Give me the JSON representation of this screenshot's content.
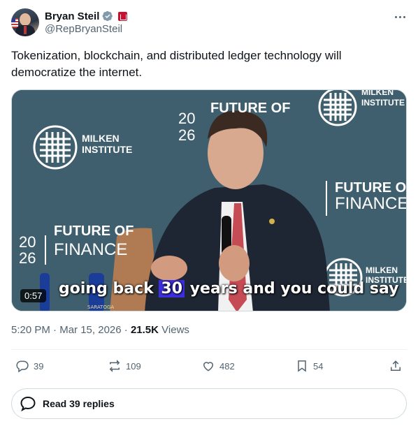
{
  "author": {
    "name": "Bryan Steil",
    "handle": "@RepBryanSteil"
  },
  "tweet": {
    "text": "Tokenization, blockchain, and distributed ledger technology will democratize the internet."
  },
  "video": {
    "duration": "0:57",
    "caption_before": "going back ",
    "caption_highlight": "30",
    "caption_after": " years and you could say",
    "backdrop": {
      "brand_line1": "MILKEN",
      "brand_line2": "INSTITUTE",
      "event_line1": "FUTURE OF",
      "event_line2": "FINANCE",
      "year_top": "20",
      "year_bottom": "26",
      "bottle_label": "SARATOGA"
    }
  },
  "meta": {
    "time": "5:20 PM",
    "separator": "·",
    "date": "Mar 15, 2026",
    "views_count": "21.5K",
    "views_label": "Views"
  },
  "actions": {
    "replies": "39",
    "reposts": "109",
    "likes": "482",
    "bookmarks": "54"
  },
  "read_replies": "Read 39 replies",
  "colors": {
    "verified": "#1d9bf0",
    "gov_badge": "#c8102e",
    "caption_highlight": "#3d2fe0",
    "backdrop": "#3c5b68"
  }
}
